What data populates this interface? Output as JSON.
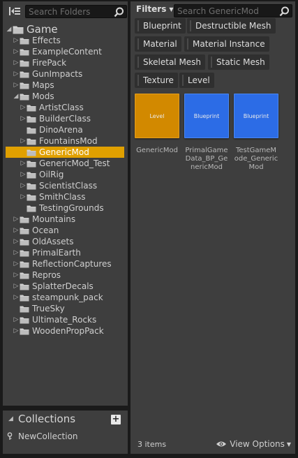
{
  "sources": {
    "search_placeholder": "Search Folders",
    "tree": [
      {
        "label": "Game",
        "level": 0,
        "expand": "open",
        "root": true
      },
      {
        "label": "Effects",
        "level": 1,
        "expand": "closed"
      },
      {
        "label": "ExampleContent",
        "level": 1,
        "expand": "closed"
      },
      {
        "label": "FirePack",
        "level": 1,
        "expand": "closed"
      },
      {
        "label": "GunImpacts",
        "level": 1,
        "expand": "closed"
      },
      {
        "label": "Maps",
        "level": 1,
        "expand": "closed"
      },
      {
        "label": "Mods",
        "level": 1,
        "expand": "open"
      },
      {
        "label": "ArtistClass",
        "level": 2,
        "expand": "closed"
      },
      {
        "label": "BuilderClass",
        "level": 2,
        "expand": "closed"
      },
      {
        "label": "DinoArena",
        "level": 2,
        "expand": "none"
      },
      {
        "label": "FountainsMod",
        "level": 2,
        "expand": "closed"
      },
      {
        "label": "GenericMod",
        "level": 2,
        "expand": "none",
        "selected": true
      },
      {
        "label": "GenericMod_Test",
        "level": 2,
        "expand": "closed"
      },
      {
        "label": "OilRig",
        "level": 2,
        "expand": "closed"
      },
      {
        "label": "ScientistClass",
        "level": 2,
        "expand": "closed"
      },
      {
        "label": "SmithClass",
        "level": 2,
        "expand": "closed"
      },
      {
        "label": "TestingGrounds",
        "level": 2,
        "expand": "none"
      },
      {
        "label": "Mountains",
        "level": 1,
        "expand": "closed"
      },
      {
        "label": "Ocean",
        "level": 1,
        "expand": "closed"
      },
      {
        "label": "OldAssets",
        "level": 1,
        "expand": "closed"
      },
      {
        "label": "PrimalEarth",
        "level": 1,
        "expand": "closed"
      },
      {
        "label": "ReflectionCaptures",
        "level": 1,
        "expand": "closed"
      },
      {
        "label": "Repros",
        "level": 1,
        "expand": "closed"
      },
      {
        "label": "SplatterDecals",
        "level": 1,
        "expand": "closed"
      },
      {
        "label": "steampunk_pack",
        "level": 1,
        "expand": "closed"
      },
      {
        "label": "TrueSky",
        "level": 1,
        "expand": "none"
      },
      {
        "label": "Ultimate_Rocks",
        "level": 1,
        "expand": "closed"
      },
      {
        "label": "WoodenPropPack",
        "level": 1,
        "expand": "closed"
      }
    ]
  },
  "collections": {
    "title": "Collections",
    "add_label": "+",
    "items": [
      {
        "label": "NewCollection"
      }
    ]
  },
  "assets": {
    "filters_label": "Filters",
    "search_placeholder": "Search GenericMod",
    "filter_chips": [
      "Blueprint",
      "Destructible Mesh",
      "Material",
      "Material Instance",
      "Skeletal Mesh",
      "Static Mesh",
      "Texture",
      "Level"
    ],
    "tiles": [
      {
        "type_label": "Level",
        "name": "GenericMod",
        "kind": "level"
      },
      {
        "type_label": "Blueprint",
        "name": "PrimalGameData_BP_GenericMod",
        "kind": "bp"
      },
      {
        "type_label": "Blueprint",
        "name": "TestGameMode_GenericMod",
        "kind": "bp"
      }
    ],
    "item_count": "3 items",
    "view_options_label": "View Options"
  },
  "colors": {
    "selection": "#e0a000",
    "level_thumb": "#d28900",
    "blueprint_thumb": "#2c6ce6",
    "panel_bg": "#3e3e3e"
  }
}
